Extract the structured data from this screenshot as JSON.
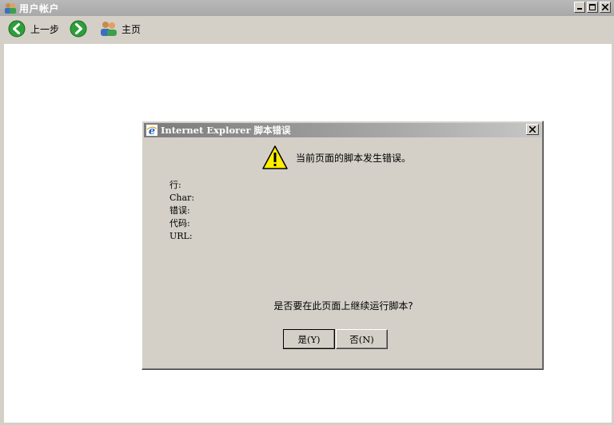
{
  "window": {
    "title": "用户帐户"
  },
  "toolbar": {
    "back_label": "上一步",
    "home_label": "主页"
  },
  "dialog": {
    "title": "Internet Explorer 脚本错误",
    "message": "当前页面的脚本发生错误。",
    "fields": [
      {
        "label": "行:"
      },
      {
        "label": "Char:"
      },
      {
        "label": "错误:"
      },
      {
        "label": "代码:"
      },
      {
        "label": "URL:"
      }
    ],
    "question": "是否要在此页面上继续运行脚本?",
    "yes_label": "是(Y)",
    "no_label": "否(N)"
  },
  "colors": {
    "arrow_green": "#2e9e3a",
    "warning_yellow": "#ffee00"
  }
}
